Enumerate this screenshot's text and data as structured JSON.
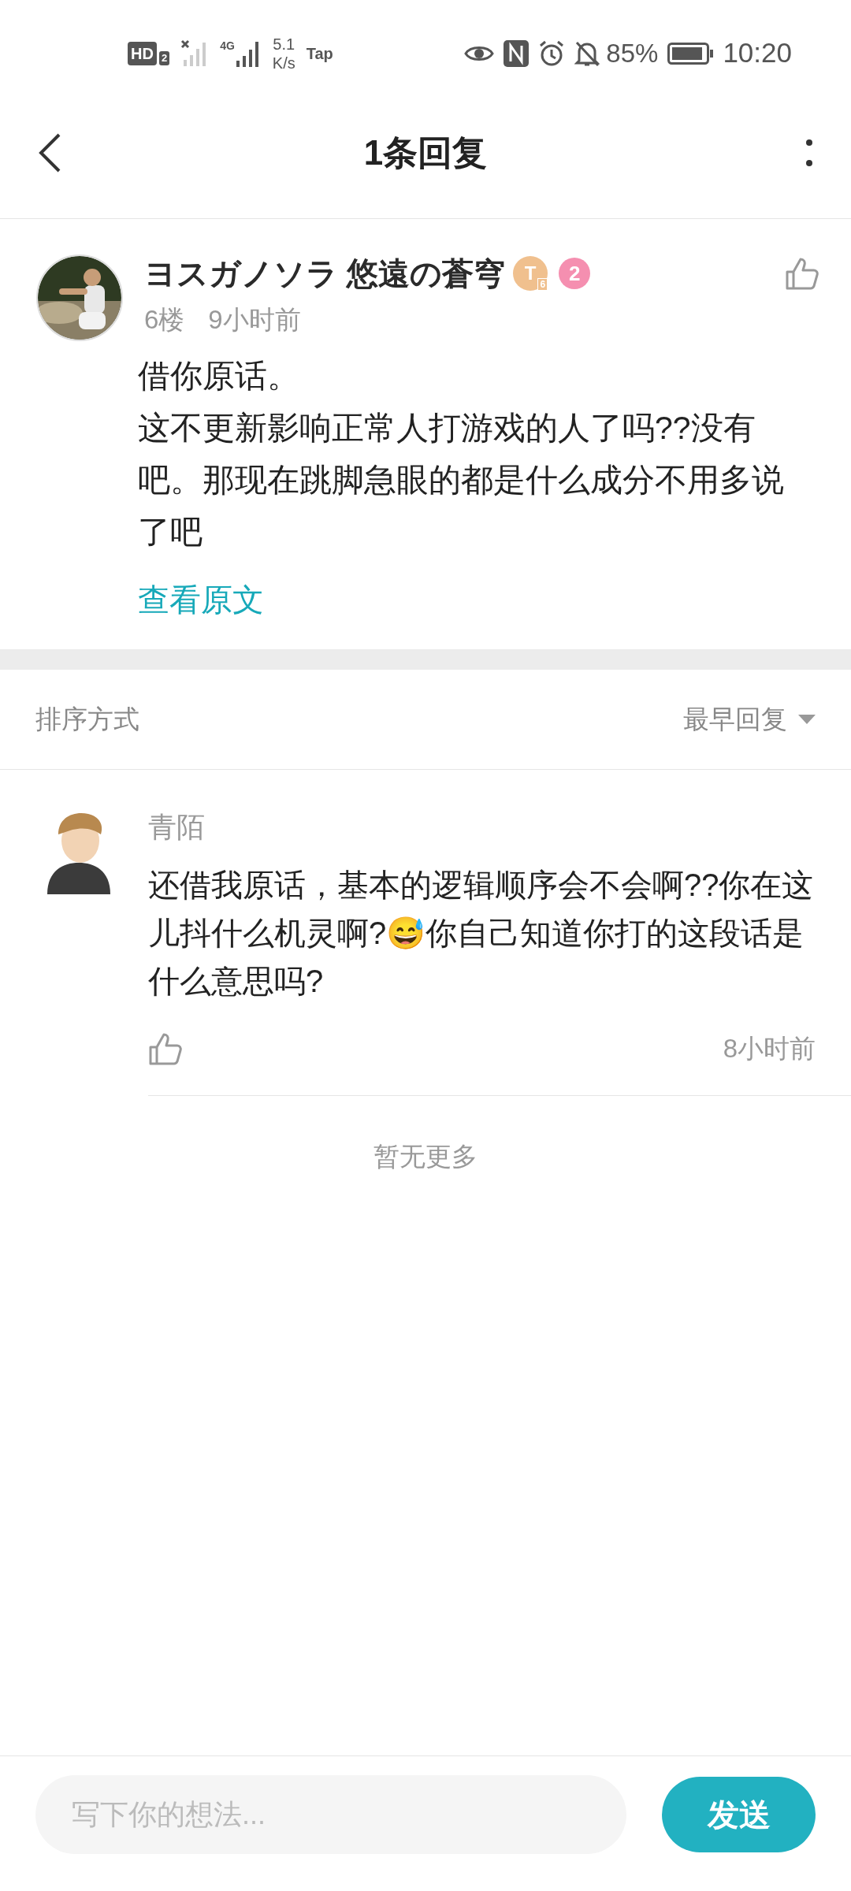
{
  "status_bar": {
    "hd_label": "HD",
    "sim_label": "2",
    "network_type": "4G",
    "speed_value": "5.1",
    "speed_unit": "K/s",
    "app_label": "Tap",
    "battery_percent": "85%",
    "time": "10:20"
  },
  "header": {
    "title": "1条回复"
  },
  "comment": {
    "author": "ヨスガノソラ 悠遠の蒼穹",
    "badges": [
      {
        "kind": "level",
        "text": "T",
        "sub": "6"
      },
      {
        "kind": "count",
        "text": "2"
      }
    ],
    "floor": "6楼",
    "time": "9小时前",
    "body": [
      "借你原话。",
      "这不更新影响正常人打游戏的人了吗??没有吧。那现在跳脚急眼的都是什么成分不用多说了吧"
    ],
    "view_original": "查看原文"
  },
  "sort": {
    "label": "排序方式",
    "value": "最早回复"
  },
  "replies": [
    {
      "author": "青陌",
      "body": "还借我原话，基本的逻辑顺序会不会啊??你在这儿抖什么机灵啊?😅你自己知道你打的这段话是什么意思吗?",
      "time": "8小时前"
    }
  ],
  "end_note": "暂无更多",
  "composer": {
    "placeholder": "写下你的想法...",
    "send": "发送"
  }
}
